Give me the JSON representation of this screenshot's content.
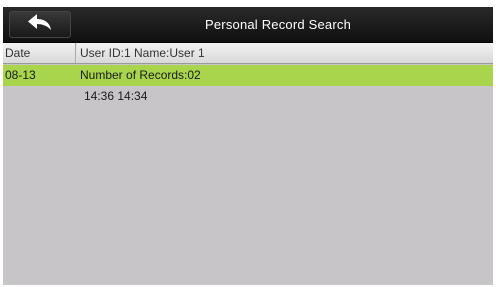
{
  "titlebar": {
    "title": "Personal Record Search",
    "back_icon": "back-arrow-icon"
  },
  "table": {
    "headers": {
      "date": "Date",
      "info": "User ID:1 Name:User 1"
    },
    "rows": [
      {
        "date": "08-13",
        "summary": "Number of Records:02",
        "times": "14:36 14:34"
      }
    ]
  },
  "colors": {
    "titlebar": "#141414",
    "selected_row": "#a8d54b",
    "background": "#c8c5c8"
  }
}
